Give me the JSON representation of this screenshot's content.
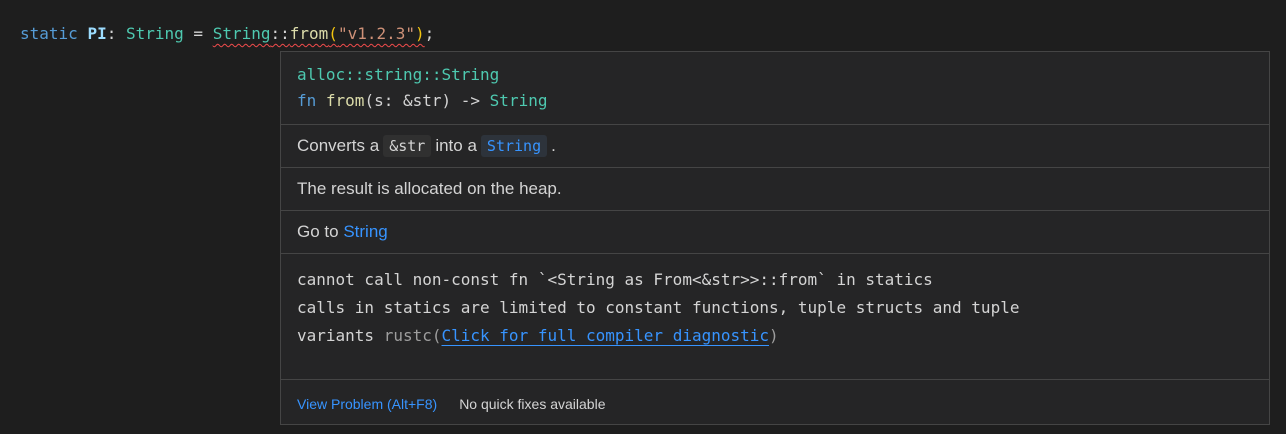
{
  "editor": {
    "code_kw": "static",
    "code_ident": "PI",
    "code_colon": ":",
    "code_type": "String",
    "code_eq": "=",
    "code_call_type": "String",
    "code_sep": "::",
    "code_fn": "from",
    "code_paren_open": "(",
    "code_str": "\"v1.2.3\"",
    "code_paren_close": ")",
    "code_semi": ";"
  },
  "hover": {
    "signature_path": "alloc::string::String",
    "signature_fn_kw": "fn",
    "signature_fn_name": "from",
    "signature_params": "(s: &str) ->",
    "signature_ret": "String",
    "doc_prefix": "Converts a",
    "doc_code1": "&str",
    "doc_middle": "into a",
    "doc_code2": "String",
    "doc_suffix": ".",
    "doc_line2": "The result is allocated on the heap.",
    "goto_label": "Go to",
    "goto_target": "String",
    "diag_line1": "cannot call non-const fn `<String as From<&str>>::from` in statics",
    "diag_line2": "calls in statics are limited to constant functions, tuple structs and tuple",
    "diag_line3_text": "variants",
    "diag_source": "rustc(",
    "diag_link": "Click for full compiler diagnostic",
    "diag_close": ")",
    "view_problem": "View Problem (Alt+F8)",
    "no_fixes": "No quick fixes available"
  },
  "colors": {
    "background": "#1e1e1e",
    "hover_background": "#252526",
    "link": "#3794ff",
    "type": "#4ec9b0",
    "keyword": "#569cd6",
    "error_squiggle": "#f14c4c"
  }
}
